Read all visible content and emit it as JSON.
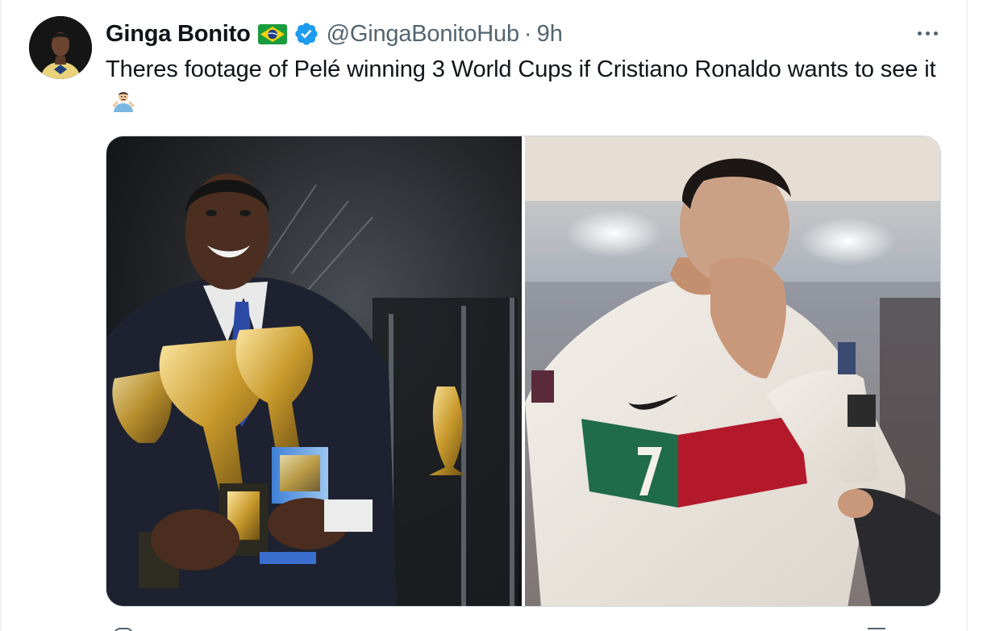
{
  "author": {
    "display_name": "Ginga Bonito",
    "handle": "@GingaBonitoHub",
    "separator": "·",
    "time": "9h",
    "flag_icon": "brazil-flag-icon",
    "verified_icon": "verified-badge-icon"
  },
  "tweet": {
    "text": "Theres footage of Pelé winning 3 World Cups if Cristiano Ronaldo wants to see it",
    "emoji_icon": "man-shrugging-icon"
  },
  "colors": {
    "text_primary": "#0f1419",
    "text_secondary": "#536471",
    "verified_blue": "#1d9bf0",
    "border": "#cfd9de"
  },
  "media": {
    "photos": [
      "pele-trophies-photo",
      "ronaldo-crying-photo"
    ]
  },
  "overflow_menu_icon": "more-horizontal-icon"
}
